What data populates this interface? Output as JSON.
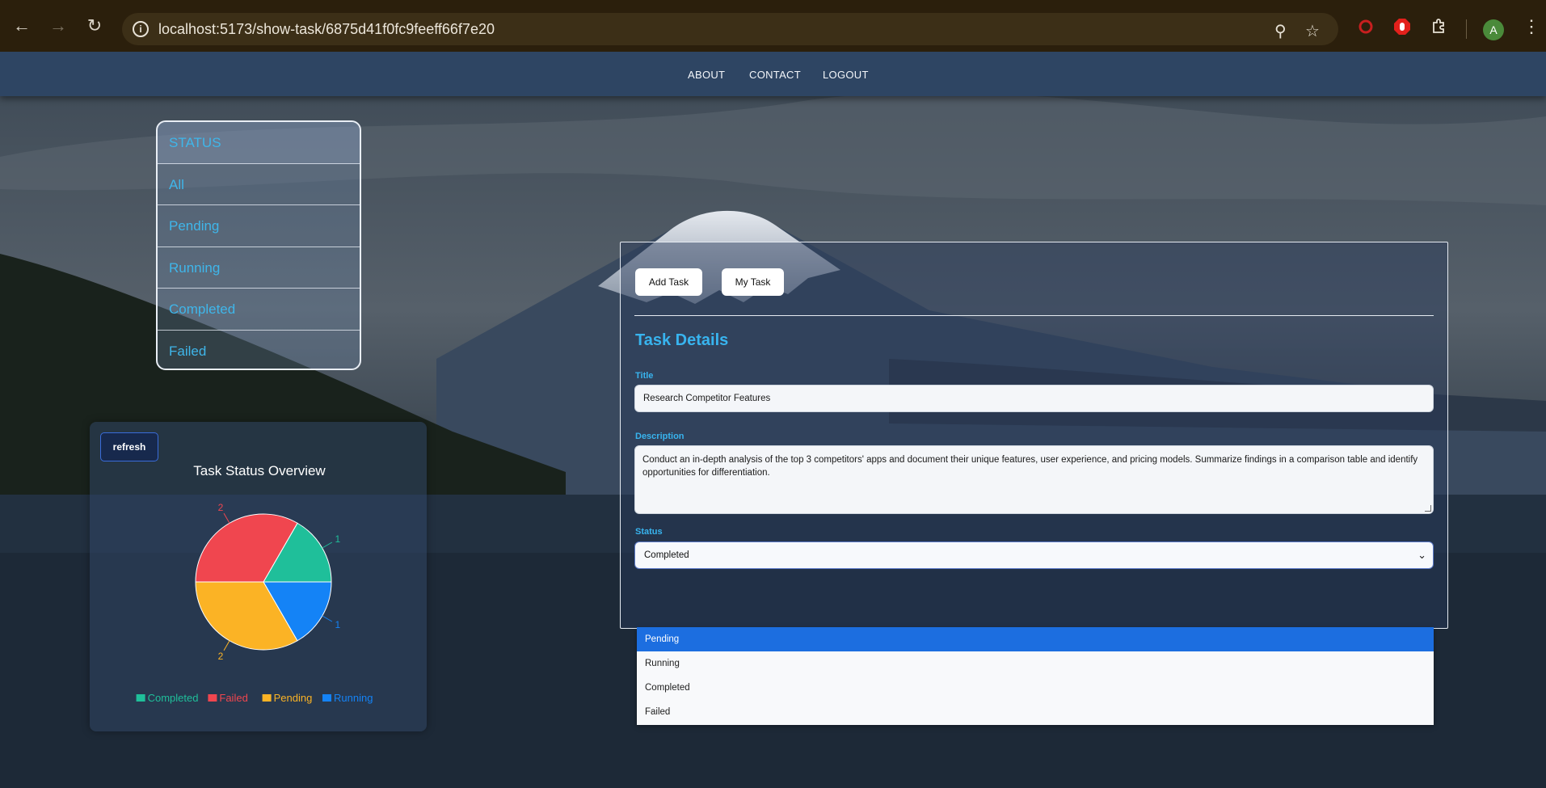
{
  "browser": {
    "url": "localhost:5173/show-task/6875d41f0fc9feeff66f7e20",
    "avatar_letter": "A"
  },
  "nav": {
    "about": "ABOUT",
    "contact": "CONTACT",
    "logout": "LOGOUT"
  },
  "status_filter": {
    "header": "STATUS",
    "items": [
      "All",
      "Pending",
      "Running",
      "Completed",
      "Failed"
    ]
  },
  "chart_card": {
    "refresh_label": "refresh"
  },
  "chart_data": {
    "type": "pie",
    "title": "Task Status Overview",
    "categories": [
      "Completed",
      "Failed",
      "Pending",
      "Running"
    ],
    "values": [
      1,
      2,
      2,
      1
    ],
    "colors": [
      "#1fbf9a",
      "#f0464f",
      "#fbb325",
      "#1483f6"
    ],
    "legend": "bottom"
  },
  "task_form": {
    "add_task_label": "Add Task",
    "my_task_label": "My Task",
    "heading": "Task Details",
    "title_label": "Title",
    "title_value": "Research Competitor Features",
    "description_label": "Description",
    "description_value": "Conduct an in-depth analysis of the top 3 competitors' apps and document their unique features, user experience, and pricing models. Summarize findings in a comparison table and identify opportunities for differentiation.",
    "status_label": "Status",
    "status_value": "Completed",
    "status_options": [
      "Pending",
      "Running",
      "Completed",
      "Failed"
    ],
    "highlighted_option": "Pending"
  },
  "colors": {
    "accent": "#38b4ef",
    "navbar": "#2e4563",
    "dropdown_highlight": "#1c6ee0"
  }
}
